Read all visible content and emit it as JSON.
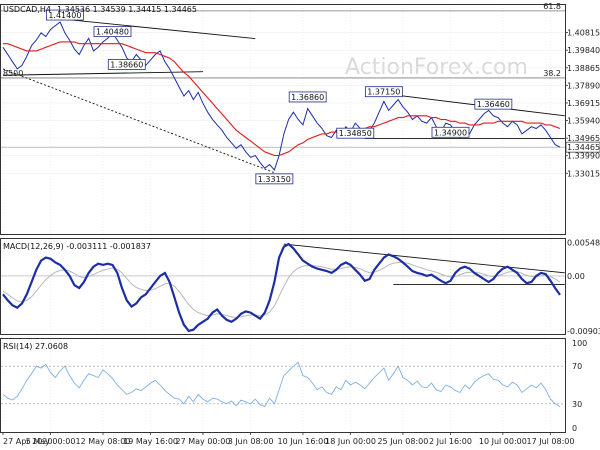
{
  "chart_data": {
    "type": "line",
    "symbol": "USDCAD,H4",
    "ohlc": "1.34536 1.34539 1.34415 1.34465",
    "watermark": "ActionForex.com",
    "price_panel": {
      "ylim": [
        1.2965,
        1.424
      ],
      "y_ticks": [
        "1.40815",
        "1.39840",
        "1.38865",
        "1.37890",
        "1.36915",
        "1.35940",
        "1.34965",
        "1.33990",
        "1.33015"
      ],
      "y_tick_values": [
        1.40815,
        1.3984,
        1.38865,
        1.3789,
        1.36915,
        1.3594,
        1.34965,
        1.3399,
        1.33015
      ],
      "current_price_label": "1.34465",
      "current_price": 1.34465,
      "fib_levels": [
        {
          "label": "61.8",
          "value": 1.4202
        },
        {
          "label": "38.2",
          "value": 1.383
        },
        {
          "label": "8500",
          "value": 1.383
        }
      ],
      "annotations": [
        {
          "label": "1.41400",
          "x": 13,
          "value": 1.414
        },
        {
          "label": "1.40480",
          "x": 23,
          "value": 1.4048
        },
        {
          "label": "1.38660",
          "x": 26,
          "value": 1.3866
        },
        {
          "label": "1.33150",
          "x": 57,
          "value": 1.3315
        },
        {
          "label": "1.36860",
          "x": 64,
          "value": 1.3686
        },
        {
          "label": "1.37150",
          "x": 80,
          "value": 1.3715
        },
        {
          "label": "1.34850",
          "x": 74,
          "value": 1.3485
        },
        {
          "label": "1.34900",
          "x": 94,
          "value": 1.349
        },
        {
          "label": "1.36460",
          "x": 103,
          "value": 1.3646
        }
      ],
      "series": [
        {
          "name": "price",
          "values": [
            1.4,
            1.396,
            1.392,
            1.388,
            1.39,
            1.395,
            1.401,
            1.404,
            1.408,
            1.406,
            1.41,
            1.412,
            1.414,
            1.408,
            1.404,
            1.399,
            1.396,
            1.401,
            1.405,
            1.398,
            1.4,
            1.403,
            1.405,
            1.408,
            1.404,
            1.4,
            1.394,
            1.392,
            1.396,
            1.393,
            1.39,
            1.393,
            1.396,
            1.398,
            1.392,
            1.388,
            1.383,
            1.378,
            1.373,
            1.376,
            1.371,
            1.375,
            1.369,
            1.364,
            1.36,
            1.357,
            1.354,
            1.35,
            1.347,
            1.344,
            1.346,
            1.342,
            1.339,
            1.34,
            1.336,
            1.333,
            1.335,
            1.332,
            1.34,
            1.352,
            1.36,
            1.364,
            1.36,
            1.357,
            1.366,
            1.362,
            1.358,
            1.355,
            1.351,
            1.35,
            1.354,
            1.351,
            1.356,
            1.353,
            1.358,
            1.355,
            1.351,
            1.354,
            1.358,
            1.364,
            1.37,
            1.365,
            1.368,
            1.371,
            1.367,
            1.364,
            1.36,
            1.362,
            1.359,
            1.358,
            1.361,
            1.356,
            1.353,
            1.358,
            1.357,
            1.353,
            1.35,
            1.355,
            1.352,
            1.357,
            1.36,
            1.363,
            1.365,
            1.362,
            1.361,
            1.358,
            1.356,
            1.359,
            1.357,
            1.352,
            1.354,
            1.356,
            1.355,
            1.357,
            1.354,
            1.35,
            1.346,
            1.3447
          ]
        },
        {
          "name": "sma",
          "values": [
            1.402,
            1.402,
            1.401,
            1.4,
            1.399,
            1.398,
            1.398,
            1.398,
            1.399,
            1.4,
            1.401,
            1.402,
            1.403,
            1.403,
            1.403,
            1.403,
            1.402,
            1.402,
            1.402,
            1.402,
            1.402,
            1.402,
            1.402,
            1.402,
            1.402,
            1.402,
            1.401,
            1.4,
            1.399,
            1.398,
            1.397,
            1.397,
            1.397,
            1.396,
            1.395,
            1.394,
            1.392,
            1.389,
            1.386,
            1.384,
            1.381,
            1.378,
            1.375,
            1.372,
            1.369,
            1.366,
            1.363,
            1.36,
            1.357,
            1.354,
            1.352,
            1.35,
            1.348,
            1.346,
            1.344,
            1.342,
            1.341,
            1.34,
            1.34,
            1.341,
            1.342,
            1.344,
            1.346,
            1.347,
            1.349,
            1.35,
            1.351,
            1.352,
            1.352,
            1.353,
            1.353,
            1.354,
            1.354,
            1.354,
            1.355,
            1.355,
            1.355,
            1.356,
            1.356,
            1.357,
            1.358,
            1.359,
            1.36,
            1.361,
            1.361,
            1.362,
            1.362,
            1.362,
            1.362,
            1.362,
            1.361,
            1.361,
            1.36,
            1.36,
            1.359,
            1.359,
            1.358,
            1.358,
            1.357,
            1.357,
            1.357,
            1.358,
            1.358,
            1.358,
            1.359,
            1.359,
            1.359,
            1.359,
            1.359,
            1.359,
            1.358,
            1.358,
            1.358,
            1.358,
            1.357,
            1.357,
            1.356,
            1.355
          ]
        }
      ],
      "trendlines": [
        {
          "from": [
            13,
            1.4155
          ],
          "to": [
            53,
            1.4048
          ]
        },
        {
          "from": [
            0,
            1.3845
          ],
          "to": [
            42,
            1.3865
          ]
        },
        {
          "from": [
            0,
            1.388
          ],
          "to": [
            57,
            1.3305
          ]
        },
        {
          "from": [
            81,
            1.374
          ],
          "to": [
            118,
            1.362
          ]
        },
        {
          "from": [
            76,
            1.3495
          ],
          "to": [
            118,
            1.3495
          ]
        }
      ]
    },
    "macd_panel": {
      "title": "MACD(12,26,9) -0.003111 -0.001837",
      "y_ticks": [
        "0.005486",
        "0.00",
        "-0.009034"
      ],
      "y_tick_values": [
        0.005486,
        0.0,
        -0.009034
      ],
      "ylim": [
        -0.0095,
        0.0062
      ],
      "series": [
        {
          "name": "macd",
          "values": [
            -0.003,
            -0.004,
            -0.0048,
            -0.0052,
            -0.0045,
            -0.003,
            -0.001,
            0.001,
            0.0025,
            0.003,
            0.0028,
            0.0022,
            0.0018,
            0.001,
            0.0,
            -0.0015,
            -0.002,
            -0.001,
            0.0005,
            0.0015,
            0.002,
            0.0018,
            0.002,
            0.0018,
            0.0005,
            -0.002,
            -0.004,
            -0.005,
            -0.0045,
            -0.0035,
            -0.003,
            -0.002,
            -0.001,
            0.0,
            0.0005,
            -0.001,
            -0.0035,
            -0.006,
            -0.008,
            -0.009,
            -0.0088,
            -0.008,
            -0.0075,
            -0.007,
            -0.006,
            -0.0055,
            -0.0065,
            -0.0072,
            -0.0075,
            -0.007,
            -0.0062,
            -0.0058,
            -0.006,
            -0.0065,
            -0.007,
            -0.006,
            -0.004,
            -0.001,
            0.003,
            0.0048,
            0.0052,
            0.0045,
            0.0035,
            0.0025,
            0.002,
            0.0015,
            0.0012,
            0.001,
            0.0008,
            0.0005,
            0.001,
            0.0018,
            0.0022,
            0.0018,
            0.001,
            0.0002,
            -0.0008,
            -0.0005,
            0.001,
            0.002,
            0.003,
            0.0035,
            0.0032,
            0.0028,
            0.0022,
            0.0015,
            0.0008,
            0.0005,
            0.0003,
            0.0,
            0.0002,
            -0.0003,
            -0.0008,
            -0.0012,
            -0.0008,
            0.0005,
            0.0012,
            0.0015,
            0.0012,
            0.0005,
            0.0,
            -0.0005,
            -0.001,
            -0.0005,
            0.0005,
            0.0012,
            0.0015,
            0.001,
            0.0005,
            -0.0005,
            -0.0012,
            -0.001,
            0.0,
            0.0005,
            0.0003,
            -0.0008,
            -0.002,
            -0.0031
          ]
        },
        {
          "name": "signal",
          "values": [
            -0.0025,
            -0.003,
            -0.0036,
            -0.0041,
            -0.0042,
            -0.004,
            -0.0034,
            -0.0025,
            -0.0015,
            -0.0006,
            0.0001,
            0.0006,
            0.0009,
            0.001,
            0.0008,
            0.0004,
            -0.0001,
            -0.0003,
            -0.0001,
            0.0002,
            0.0006,
            0.0009,
            0.0011,
            0.0013,
            0.0011,
            0.0005,
            -0.0004,
            -0.0013,
            -0.0019,
            -0.0022,
            -0.0024,
            -0.0023,
            -0.0021,
            -0.0017,
            -0.0013,
            -0.0012,
            -0.0017,
            -0.0025,
            -0.0036,
            -0.0047,
            -0.0055,
            -0.006,
            -0.0063,
            -0.0065,
            -0.0064,
            -0.0062,
            -0.0063,
            -0.0065,
            -0.0067,
            -0.0068,
            -0.0067,
            -0.0065,
            -0.0064,
            -0.0064,
            -0.0065,
            -0.0064,
            -0.0059,
            -0.0049,
            -0.0033,
            -0.0017,
            -0.0003,
            0.0007,
            0.0013,
            0.0016,
            0.0017,
            0.0017,
            0.0016,
            0.0015,
            0.0013,
            0.0011,
            0.0011,
            0.0012,
            0.0014,
            0.0015,
            0.0014,
            0.0012,
            0.0008,
            0.0005,
            0.0006,
            0.0009,
            0.0013,
            0.0018,
            0.0021,
            0.0022,
            0.0022,
            0.0021,
            0.0018,
            0.0015,
            0.0013,
            0.001,
            0.0008,
            0.0006,
            0.0003,
            0.0,
            -0.0002,
            -0.0001,
            0.0002,
            0.0005,
            0.0006,
            0.0006,
            0.0005,
            0.0003,
            0.0,
            -0.0001,
            0.0,
            0.0003,
            0.0006,
            0.0007,
            0.0007,
            0.0004,
            0.0001,
            -0.0001,
            -0.0001,
            0.0,
            0.0001,
            -0.0001,
            -0.0005,
            -0.001
          ]
        }
      ],
      "trendlines": [
        {
          "from": [
            59,
            0.0052
          ],
          "to": [
            118,
            0.0005
          ]
        },
        {
          "from": [
            82,
            -0.0014
          ],
          "to": [
            118,
            -0.0014
          ]
        }
      ]
    },
    "rsi_panel": {
      "title": "RSI(14) 27.0608",
      "y_ticks": [
        "100",
        "70",
        "30",
        "0"
      ],
      "y_tick_values": [
        100,
        70,
        30,
        0
      ],
      "ylim": [
        0,
        100
      ],
      "levels": [
        70,
        30
      ],
      "series": [
        {
          "name": "rsi",
          "values": [
            40,
            36,
            34,
            38,
            46,
            55,
            62,
            70,
            68,
            72,
            63,
            58,
            65,
            70,
            60,
            52,
            47,
            55,
            62,
            60,
            58,
            66,
            62,
            57,
            50,
            45,
            40,
            42,
            46,
            44,
            48,
            52,
            55,
            50,
            44,
            40,
            36,
            35,
            30,
            38,
            32,
            40,
            35,
            32,
            36,
            35,
            32,
            30,
            33,
            28,
            34,
            32,
            30,
            35,
            29,
            27,
            36,
            30,
            45,
            60,
            65,
            70,
            74,
            60,
            58,
            52,
            45,
            48,
            42,
            40,
            48,
            45,
            55,
            50,
            53,
            50,
            46,
            52,
            58,
            63,
            68,
            55,
            62,
            70,
            58,
            55,
            50,
            54,
            48,
            47,
            52,
            45,
            43,
            50,
            48,
            44,
            42,
            50,
            46,
            53,
            57,
            60,
            62,
            56,
            55,
            50,
            48,
            53,
            50,
            42,
            46,
            50,
            47,
            52,
            45,
            35,
            30,
            27
          ]
        }
      ]
    },
    "x_ticks": [
      "27 Apr 2020",
      "5 May 00:00",
      "12 May 08:00",
      "19 May 16:00",
      "27 May 00:00",
      "3 Jun 08:00",
      "10 Jun 16:00",
      "18 Jun 00:00",
      "25 Jun 08:00",
      "2 Jul 16:00",
      "10 Jul 00:00",
      "17 Jul 08:00"
    ],
    "x_tick_index": [
      0,
      10,
      21,
      31,
      42,
      52,
      63,
      73,
      84,
      94,
      105,
      115
    ],
    "n_points": 118
  }
}
